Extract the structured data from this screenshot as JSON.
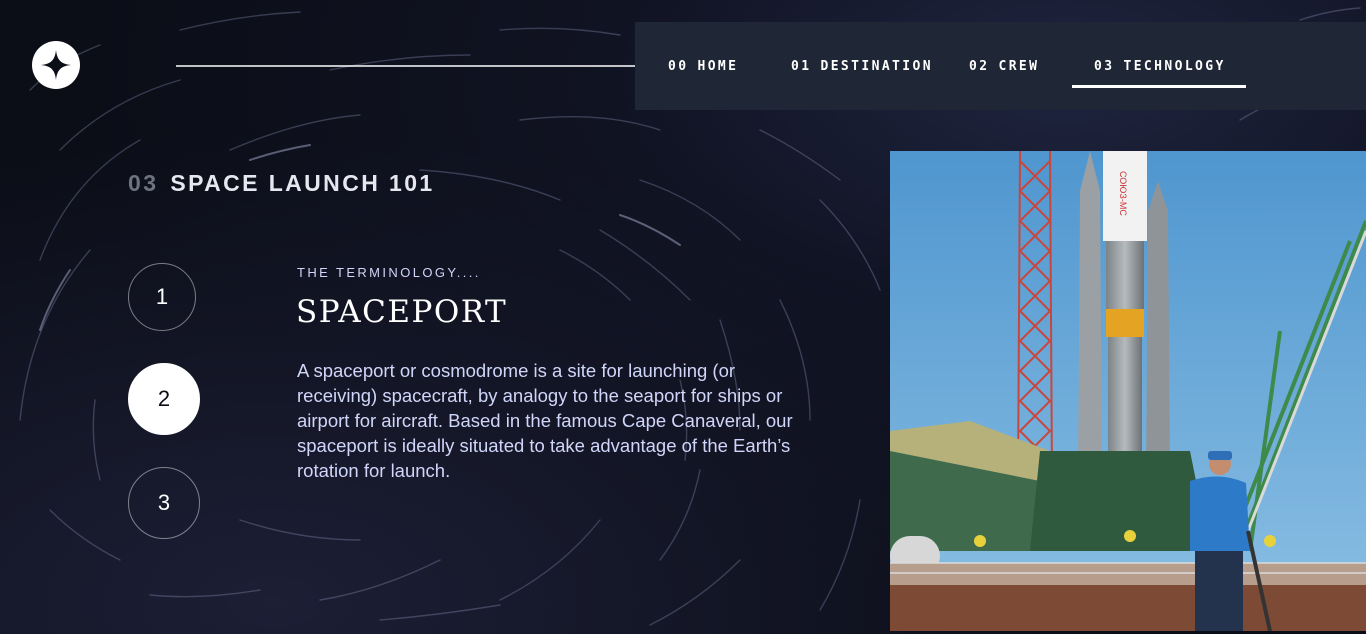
{
  "logo": {
    "icon": "star-logo-icon"
  },
  "nav": {
    "items": [
      {
        "num": "00",
        "label": "HOME",
        "active": false
      },
      {
        "num": "01",
        "label": "DESTINATION",
        "active": false
      },
      {
        "num": "02",
        "label": "CREW",
        "active": false
      },
      {
        "num": "03",
        "label": "TECHNOLOGY",
        "active": true
      }
    ]
  },
  "section": {
    "num": "03",
    "title": "SPACE LAUNCH 101"
  },
  "steps": [
    {
      "label": "1",
      "active": false
    },
    {
      "label": "2",
      "active": true
    },
    {
      "label": "3",
      "active": false
    }
  ],
  "content": {
    "eyebrow": "THE TERMINOLOGY....",
    "heading": "SPACEPORT",
    "description": "A spaceport or cosmodrome is a site for launching (or receiving) spacecraft, by analogy to the seaport for ships or airport for aircraft. Based in the famous Cape Canaveral, our spaceport is ideally situated to take advantage of the Earth’s rotation for launch."
  },
  "colors": {
    "background": "#0b0d17",
    "nav_background": "#1f2636",
    "text_secondary": "#d0d6f9",
    "accent_white": "#ffffff"
  }
}
